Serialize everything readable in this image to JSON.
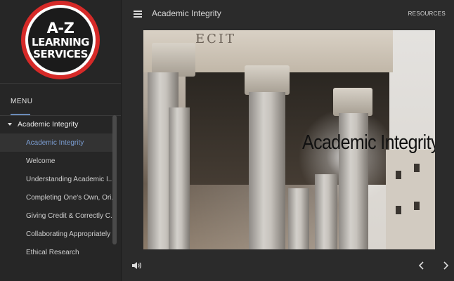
{
  "logo": {
    "line1": "A-Z",
    "line2": "LEARNING",
    "line3": "SERVICES",
    "colors": {
      "ring": "#d62a28",
      "inner": "#1b1b1b"
    }
  },
  "sidebar": {
    "menu_label": "MENU",
    "section": "Academic Integrity",
    "items": [
      {
        "label": "Academic Integrity",
        "active": true
      },
      {
        "label": "Welcome",
        "active": false
      },
      {
        "label": "Understanding Academic I...",
        "active": false
      },
      {
        "label": "Completing One's Own, Ori...",
        "active": false
      },
      {
        "label": "Giving Credit & Correctly C...",
        "active": false
      },
      {
        "label": "Collaborating Appropriately",
        "active": false
      },
      {
        "label": "Ethical Research",
        "active": false
      }
    ]
  },
  "topbar": {
    "title": "Academic Integrity",
    "resources": "RESOURCES",
    "menu_icon": "hamburger-icon"
  },
  "slide": {
    "title": "Academic Integrity",
    "inscription": "ECIT"
  },
  "controls": {
    "audio_icon": "speaker-icon",
    "prev_icon": "chevron-left-icon",
    "next_icon": "chevron-right-icon"
  },
  "theme": {
    "accent": "#7a9cd0",
    "background": "#2b2b2b",
    "sidebar": "#262626"
  }
}
